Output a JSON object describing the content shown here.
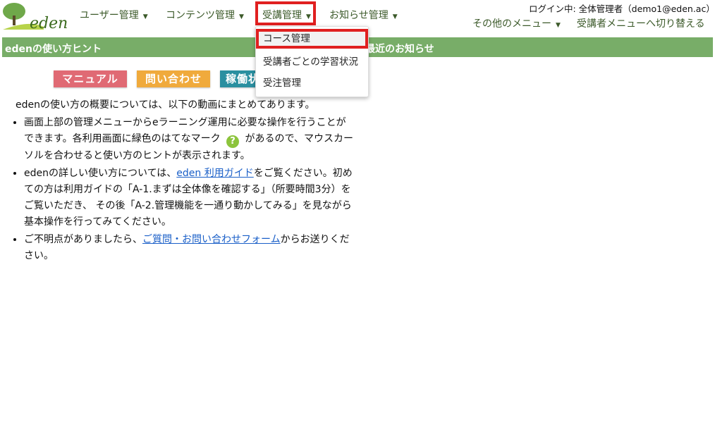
{
  "logo": {
    "text": "eden"
  },
  "nav": {
    "items": [
      {
        "label": "ユーザー管理"
      },
      {
        "label": "コンテンツ管理"
      },
      {
        "label": "受講管理"
      },
      {
        "label": "お知らせ管理"
      }
    ],
    "caret": "▼"
  },
  "login": {
    "text": "ログイン中: 全体管理者（demo1@eden.ac）"
  },
  "subnav": {
    "other_menu": "その他のメニュー",
    "switch_menu": "受講者メニューへ切り替える"
  },
  "sections": {
    "hint_title": "edenの使い方ヒント",
    "news_title": "最近のお知らせ"
  },
  "buttons": {
    "manual": "マニュアル",
    "contact": "問い合わせ",
    "status": "稼働状況"
  },
  "content": {
    "intro": "edenの使い方の概要については、以下の動画にまとめてあります。",
    "b1_text1": "画面上部の管理メニューからeラーニング運用に必要な操作を行うことができます。各利用画面に緑色のはてなマーク",
    "b1_icon": "?",
    "b1_text2": "があるので、マウスカーソルを合わせると使い方のヒントが表示されます。",
    "b2_text1": "edenの詳しい使い方については、",
    "b2_link": "eden 利用ガイド",
    "b2_text2": "をご覧ください。初めての方は利用ガイドの「A-1.まずは全体像を確認する」（所要時間3分）をご覧いただき、 その後「A-2.管理機能を一通り動かしてみる」を見ながら基本操作を行ってみてください。",
    "b3_text1": "ご不明点がありましたら、",
    "b3_link": "ご質問・お問い合わせフォーム",
    "b3_text2": "からお送りください。"
  },
  "dropdown": {
    "items": [
      {
        "label": "コース管理"
      },
      {
        "label": "受講者ごとの学習状況"
      },
      {
        "label": "受注管理"
      }
    ]
  },
  "colors": {
    "section_bar": "#78ad68",
    "highlight": "#e02020",
    "link": "#1a5fc8"
  }
}
